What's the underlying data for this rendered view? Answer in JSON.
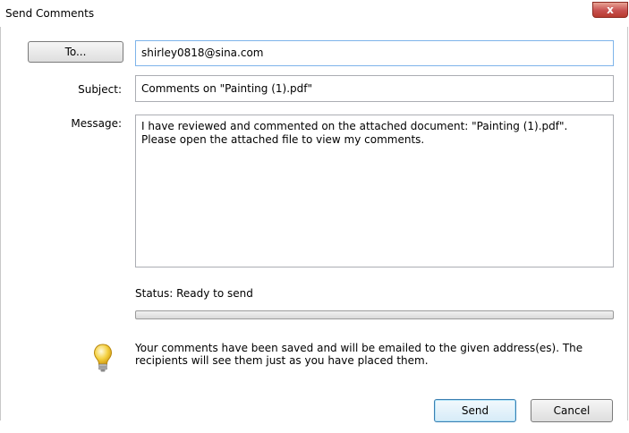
{
  "window": {
    "title": "Send Comments",
    "close_glyph": "x"
  },
  "form": {
    "to_button": "To...",
    "to_value": "shirley0818@sina.com",
    "subject_label": "Subject:",
    "subject_value": "Comments on \"Painting (1).pdf\"",
    "message_label": "Message:",
    "message_value": "I have reviewed and commented on the attached document: \"Painting (1).pdf\".\nPlease open the attached file to view my comments."
  },
  "status": {
    "text": "Status: Ready to send",
    "progress": 0
  },
  "info": {
    "icon": "lightbulb-icon",
    "text": "Your comments have been saved and will be emailed to the given address(es). The recipients will see them just as you have placed them."
  },
  "buttons": {
    "send": "Send",
    "cancel": "Cancel"
  },
  "colors": {
    "accent": "#3c7fb1",
    "close": "#c75050",
    "bulb": "#f4d03f"
  }
}
